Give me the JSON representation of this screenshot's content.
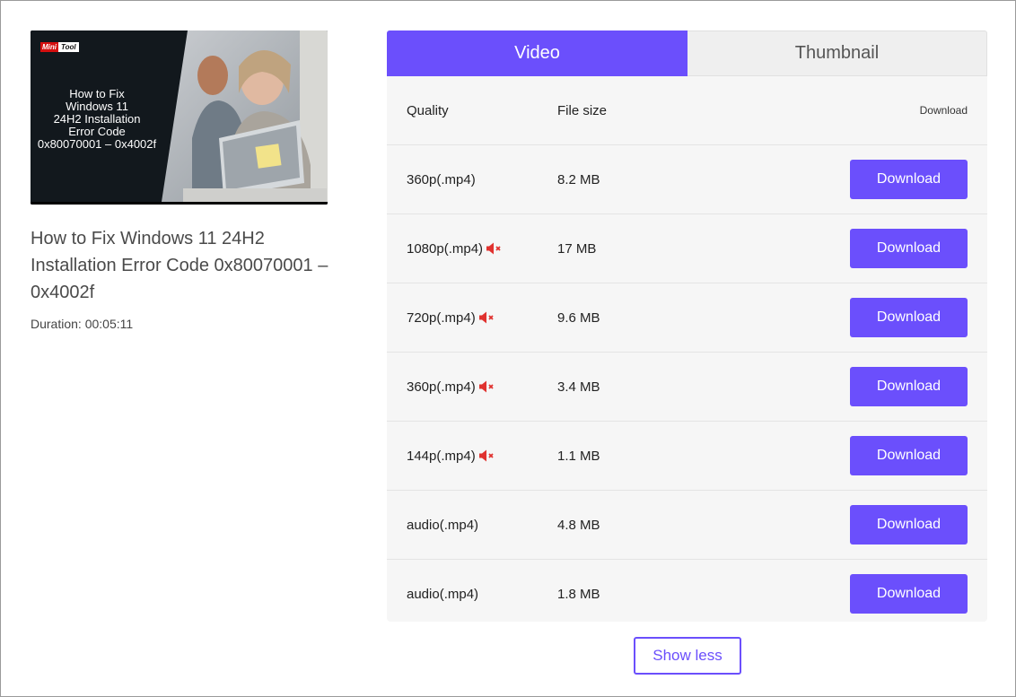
{
  "thumbnail": {
    "logo_mini": "Mini",
    "logo_tool": "Tool",
    "title_lines": [
      "How to Fix",
      "Windows 11",
      "24H2 Installation",
      "Error Code",
      "0x80070001 – 0x4002f"
    ]
  },
  "video": {
    "title": "How to Fix Windows 11 24H2 Installation Error Code 0x80070001 – 0x4002f",
    "duration": "Duration: 00:05:11"
  },
  "tabs": [
    {
      "label": "Video",
      "active": true
    },
    {
      "label": "Thumbnail",
      "active": false
    }
  ],
  "table": {
    "headers": {
      "quality": "Quality",
      "size": "File size",
      "download": "Download"
    },
    "rows": [
      {
        "quality": "360p(.mp4)",
        "size": "8.2 MB",
        "muted": false,
        "button": "Download"
      },
      {
        "quality": "1080p(.mp4)",
        "size": "17 MB",
        "muted": true,
        "button": "Download"
      },
      {
        "quality": "720p(.mp4)",
        "size": "9.6 MB",
        "muted": true,
        "button": "Download"
      },
      {
        "quality": "360p(.mp4)",
        "size": "3.4 MB",
        "muted": true,
        "button": "Download"
      },
      {
        "quality": "144p(.mp4)",
        "size": "1.1 MB",
        "muted": true,
        "button": "Download"
      },
      {
        "quality": "audio(.mp4)",
        "size": "4.8 MB",
        "muted": false,
        "button": "Download"
      },
      {
        "quality": "audio(.mp4)",
        "size": "1.8 MB",
        "muted": false,
        "button": "Download"
      }
    ]
  },
  "show_less": "Show less",
  "icons": {
    "mute": "speaker-muted-icon"
  },
  "colors": {
    "accent": "#6b4ffc",
    "mute": "#e0322f"
  }
}
